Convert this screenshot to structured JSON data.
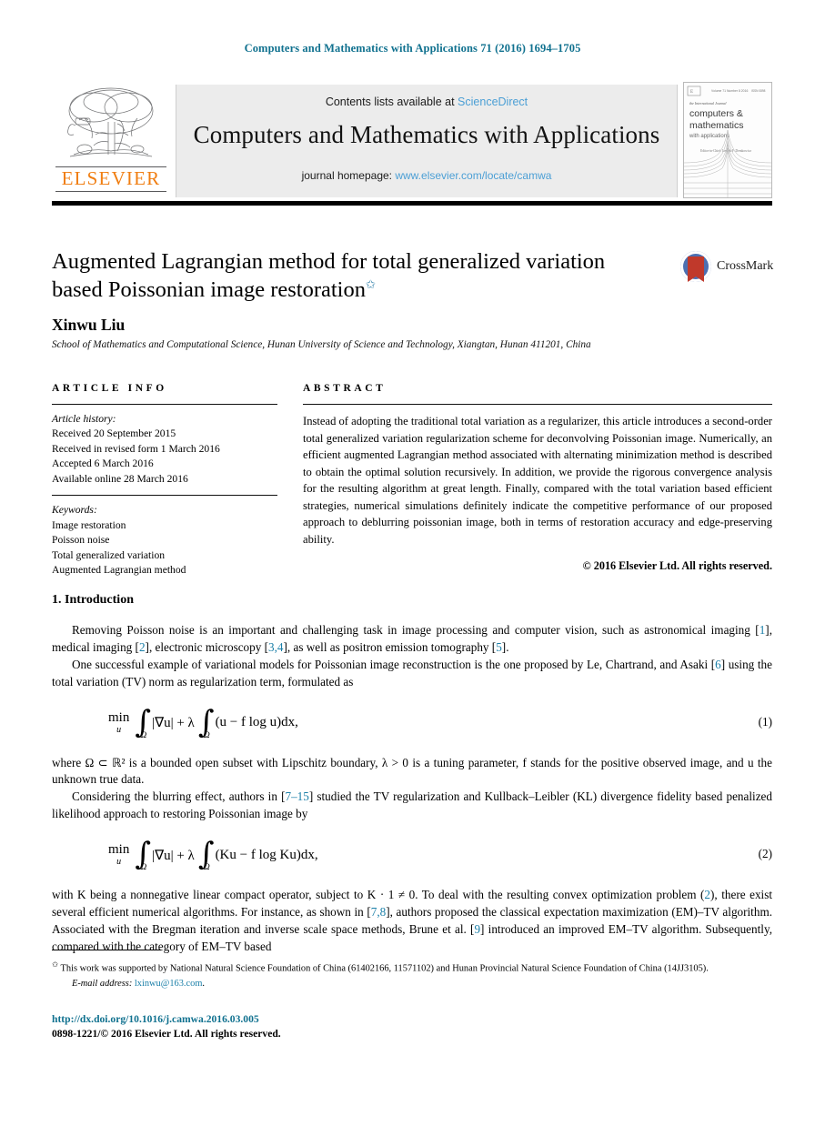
{
  "running_head": "Computers and Mathematics with Applications 71 (2016) 1694–1705",
  "masthead": {
    "publisher_name": "ELSEVIER",
    "contents_prefix": "Contents lists available at",
    "contents_link": "ScienceDirect",
    "journal_title": "Computers and Mathematics with Applications",
    "homepage_prefix": "journal homepage:",
    "homepage_link": "www.elsevier.com/locate/camwa",
    "cover_line1": "the International Journal",
    "cover_line2": "computers &",
    "cover_line3": "mathematics",
    "cover_line4": "with applications",
    "cover_editors": "Editor-in-Chief: Leszek F. Demkowicz"
  },
  "article": {
    "title": "Augmented Lagrangian method for total generalized variation based Poissonian image restoration",
    "title_footnote_mark": "✩",
    "author": "Xinwu Liu",
    "affiliation": "School of Mathematics and Computational Science, Hunan University of Science and Technology, Xiangtan, Hunan 411201, China",
    "crossmark_label": "CrossMark"
  },
  "article_info": {
    "heading": "ARTICLE INFO",
    "history_label": "Article history:",
    "history": [
      "Received 20 September 2015",
      "Received in revised form 1 March 2016",
      "Accepted 6 March 2016",
      "Available online 28 March 2016"
    ],
    "keywords_label": "Keywords:",
    "keywords": [
      "Image restoration",
      "Poisson noise",
      "Total generalized variation",
      "Augmented Lagrangian method"
    ]
  },
  "abstract": {
    "heading": "ABSTRACT",
    "text": "Instead of adopting the traditional total variation as a regularizer, this article introduces a second-order total generalized variation regularization scheme for deconvolving Poissonian image. Numerically, an efficient augmented Lagrangian method associated with alternating minimization method is described to obtain the optimal solution recursively. In addition, we provide the rigorous convergence analysis for the resulting algorithm at great length. Finally, compared with the total variation based efficient strategies, numerical simulations definitely indicate the competitive performance of our proposed approach to deblurring poissonian image, both in terms of restoration accuracy and edge-preserving ability.",
    "copyright": "© 2016 Elsevier Ltd. All rights reserved."
  },
  "introduction": {
    "heading": "1. Introduction",
    "para1_a": "Removing Poisson noise is an important and challenging task in image processing and computer vision, such as astronomical imaging [",
    "cite1": "1",
    "para1_b": "], medical imaging [",
    "cite2": "2",
    "para1_c": "], electronic microscopy [",
    "cite3": "3,4",
    "para1_d": "], as well as positron emission tomography [",
    "cite4": "5",
    "para1_e": "].",
    "para2_a": "One successful example of variational models for Poissonian image reconstruction is the one proposed by Le, Chartrand, and Asaki [",
    "cite5": "6",
    "para2_b": "] using the total variation (TV) norm as regularization term, formulated as",
    "para3": "where Ω ⊂ ℝ² is a bounded open subset with Lipschitz boundary, λ > 0 is a tuning parameter, f stands for the positive observed image, and u the unknown true data.",
    "para4_a": "Considering the blurring effect, authors in [",
    "cite6": "7–15",
    "para4_b": "] studied the TV regularization and Kullback–Leibler (KL) divergence fidelity based penalized likelihood approach to restoring Poissonian image by",
    "para5_a": "with K being a nonnegative linear compact operator, subject to K · 1 ≠ 0. To deal with the resulting convex optimization problem (",
    "cite7": "2",
    "para5_b": "), there exist several efficient numerical algorithms. For instance, as shown in [",
    "cite8": "7,8",
    "para5_c": "], authors proposed the classical expectation maximization (EM)–TV algorithm. Associated with the Bregman iteration and inverse scale space methods, Brune et al. [",
    "cite9": "9",
    "para5_d": "] introduced an improved EM–TV algorithm. Subsequently, compared with the category of EM–TV based"
  },
  "equations": {
    "eq1": {
      "min_op": "min",
      "min_sub": "u",
      "int1_sub": "Ω",
      "term1": "|∇u| + λ",
      "int2_sub": "Ω",
      "term2": "(u − f log u)dx,",
      "number": "(1)"
    },
    "eq2": {
      "min_op": "min",
      "min_sub": "u",
      "int1_sub": "Ω",
      "term1": "|∇u| + λ",
      "int2_sub": "Ω",
      "term2": "(Ku − f log Ku)dx,",
      "number": "(2)"
    }
  },
  "footnotes": {
    "star": "✩",
    "funding": "This work was supported by National Natural Science Foundation of China (61402166, 11571102) and Hunan Provincial Natural Science Foundation of China (14JJ3105).",
    "email_label": "E-mail address:",
    "email": "lxinwu@163.com",
    "email_suffix": ".",
    "doi": "http://dx.doi.org/10.1016/j.camwa.2016.03.005",
    "issn": "0898-1221/© 2016 Elsevier Ltd. All rights reserved."
  },
  "colors": {
    "header_blue": "#10718f",
    "link_blue": "#4b9fd5",
    "citation_blue": "#1a7fa8",
    "elsevier_orange": "#f07e12",
    "banner_gray": "#ececec"
  }
}
